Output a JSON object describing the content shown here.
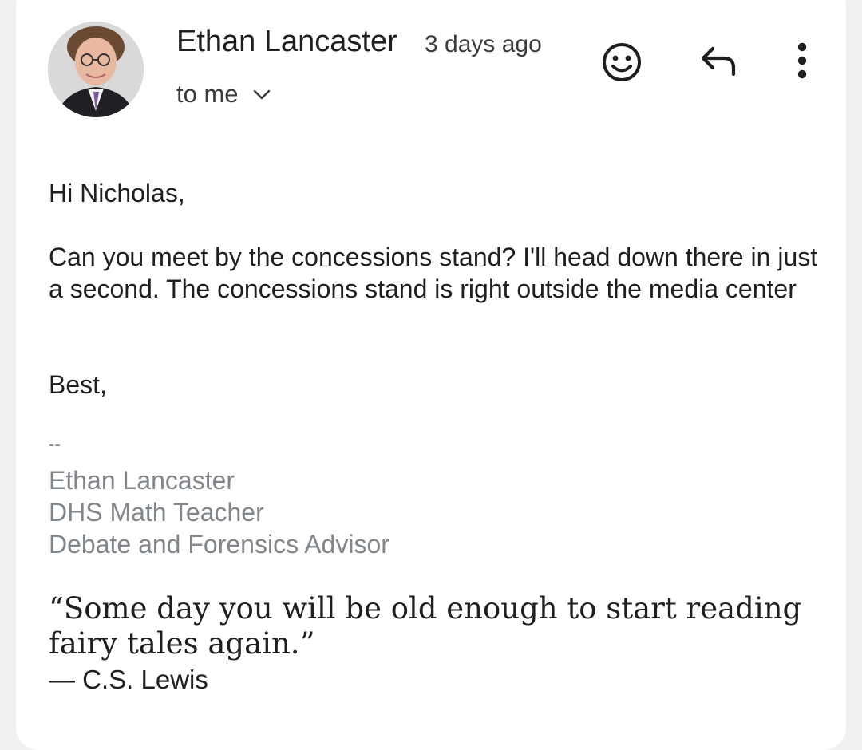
{
  "header": {
    "sender_name": "Ethan Lancaster",
    "timestamp": "3 days ago",
    "recipients_label": "to me",
    "icons": {
      "avatar": "sender-avatar",
      "recipients_toggle": "chevron-down-icon",
      "emoji_reaction": "smiley-icon",
      "reply": "reply-arrow-icon",
      "more": "more-vertical-icon"
    }
  },
  "body": {
    "greeting": "Hi Nicholas,",
    "paragraph": "Can you meet by the concessions stand? I'll head down there in just a second. The concessions stand is right outside the media center",
    "closing": "Best,"
  },
  "signature": {
    "separator": "--",
    "name": "Ethan Lancaster",
    "title": "DHS Math Teacher",
    "role": "Debate and Forensics Advisor"
  },
  "quote": {
    "text": " “Some day you will be old enough to start reading fairy tales again.”",
    "author": "— C.S. Lewis"
  },
  "colors": {
    "page_background": "#eef0f2",
    "card_background": "#ffffff",
    "primary_text": "#1f1f1f",
    "secondary_text": "#3c3c3c",
    "signature_text": "#80868b"
  }
}
